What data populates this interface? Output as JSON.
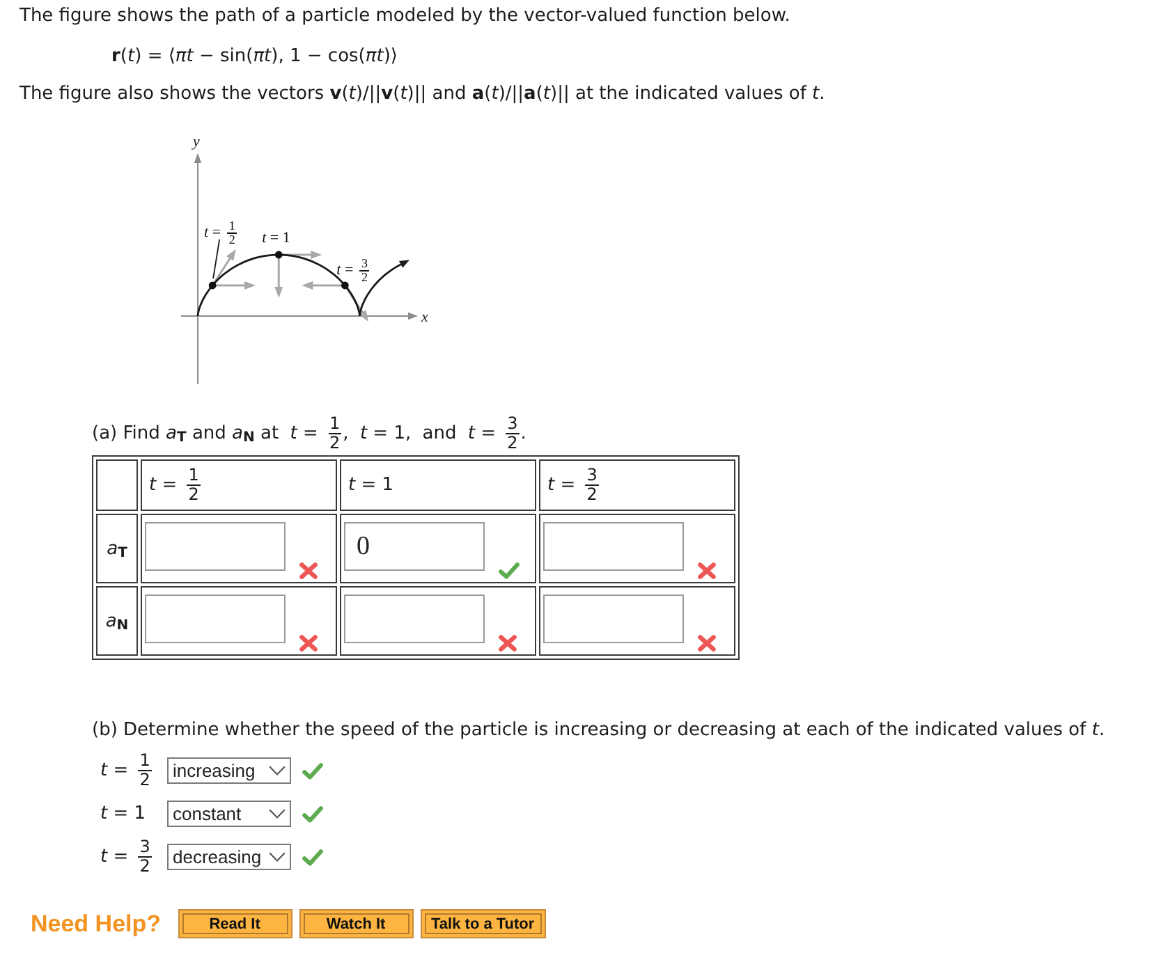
{
  "intro": "The figure shows the path of a particle modeled by the vector-valued function below.",
  "formula": "**r**(*t*) = ⟨*πt* − sin(*πt*), 1 − cos(*πt*)⟩",
  "note": "The figure also shows the vectors **v**(*t*)/||**v**(*t*)|| and **a**(*t*)/||**a**(*t*)|| at the indicated values of *t*.",
  "figure": {
    "y_axis_label": "y",
    "x_axis_label": "x",
    "points": [
      {
        "label": {
          "kind": "fraction",
          "prefix": "*t* =",
          "numerator": "1",
          "denominator": "2"
        }
      },
      {
        "label": {
          "kind": "text",
          "text": "*t* = 1"
        }
      },
      {
        "label": {
          "kind": "fraction",
          "prefix": "*t* =",
          "numerator": "3",
          "denominator": "2"
        }
      }
    ]
  },
  "part_a": {
    "prompt": [
      {
        "kind": "text",
        "text": "(a) Find  *a*$_{T}$ and *a*$_{N}$ at"
      },
      {
        "kind": "fraction",
        "prefix": "*t* =",
        "numerator": "1",
        "denominator": "2",
        "suffix": ","
      },
      {
        "kind": "text",
        "text": "*t* = 1,"
      },
      {
        "kind": "text",
        "text": "and"
      },
      {
        "kind": "fraction",
        "prefix": "*t* =",
        "numerator": "3",
        "denominator": "2",
        "suffix": "."
      }
    ],
    "table": {
      "columns": [
        {
          "kind": "fraction",
          "prefix": "*t* =",
          "numerator": "1",
          "denominator": "2"
        },
        {
          "kind": "text",
          "text": "*t* = 1"
        },
        {
          "kind": "fraction",
          "prefix": "*t* =",
          "numerator": "3",
          "denominator": "2"
        }
      ],
      "rows": [
        {
          "label": "*a*$_{T}$",
          "cells": [
            {
              "correct": false
            },
            {
              "value": "0",
              "correct": true
            },
            {
              "correct": false
            }
          ]
        },
        {
          "label": "*a*$_{N}$",
          "cells": [
            {
              "correct": false
            },
            {
              "correct": false
            },
            {
              "correct": false
            }
          ]
        }
      ]
    }
  },
  "part_b": {
    "prompt": "(b) Determine whether the speed of the particle is increasing or decreasing at each of the indicated values of *t*.",
    "rows": [
      {
        "t_label": {
          "kind": "fraction",
          "prefix": "*t* =",
          "numerator": "1",
          "denominator": "2"
        },
        "answer": "increasing",
        "correct": true
      },
      {
        "t_label": {
          "kind": "text",
          "text": "*t* = 1"
        },
        "answer": "constant",
        "correct": true
      },
      {
        "t_label": {
          "kind": "fraction",
          "prefix": "*t* =",
          "numerator": "3",
          "denominator": "2"
        },
        "answer": "decreasing",
        "correct": true
      }
    ]
  },
  "help": {
    "label": "Need Help?",
    "buttons": [
      "Read It",
      "Watch It",
      "Talk to a Tutor"
    ]
  }
}
